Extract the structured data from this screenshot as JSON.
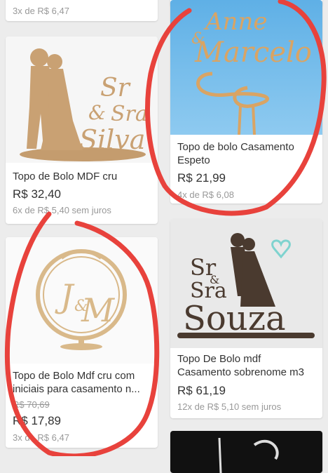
{
  "top_fragment": {
    "installment": "3x de R$ 6,47"
  },
  "products": [
    {
      "id": "mdf-sr-sra-silva",
      "title": "Topo de Bolo MDF cru",
      "price": "R$ 32,40",
      "installment": "6x de R$ 5,40 sem juros",
      "image_text": [
        "Sr",
        "&",
        "Sra",
        "Silva"
      ]
    },
    {
      "id": "casamento-espeto",
      "title": "Topo de bolo Casamento Espeto",
      "price": "R$ 21,99",
      "installment": "4x de R$ 6,08",
      "image_text": [
        "Anne",
        "&",
        "Marcelo"
      ]
    },
    {
      "id": "mdf-iniciais",
      "title": "Topo de Bolo Mdf cru com iniciais para casamento n...",
      "old_price": "R$ 70,69",
      "price": "R$ 17,89",
      "installment": "3x de R$ 6,47",
      "image_text": [
        "J",
        "&",
        "M"
      ]
    },
    {
      "id": "sobrenome-m3",
      "title": "Topo De Bolo mdf Casamento sobrenome m3",
      "price": "R$ 61,19",
      "installment": "12x de R$ 5,10 sem juros",
      "image_text": [
        "Sr",
        "&",
        "Sra",
        "Souza"
      ]
    }
  ],
  "colors": {
    "background": "#ececec",
    "card": "#ffffff",
    "text": "#333333",
    "muted": "#999999",
    "mdf": "#c9a173",
    "annotation_red": "#e8423c"
  }
}
